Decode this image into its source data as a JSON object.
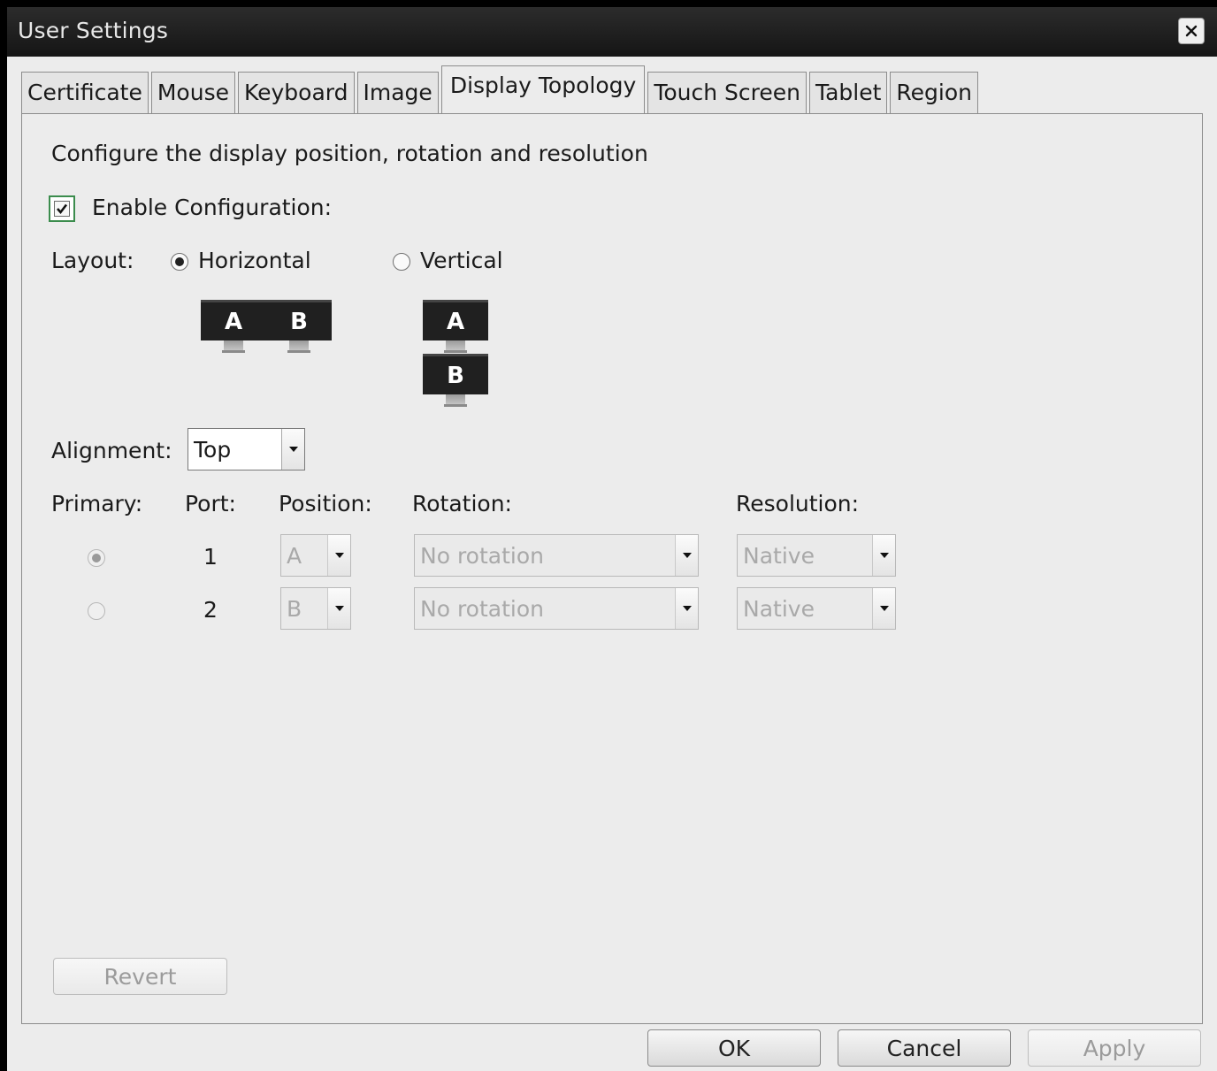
{
  "window": {
    "title": "User Settings",
    "close_icon": "close-icon"
  },
  "tabs": [
    {
      "label": "Certificate",
      "active": false
    },
    {
      "label": "Mouse",
      "active": false
    },
    {
      "label": "Keyboard",
      "active": false
    },
    {
      "label": "Image",
      "active": false
    },
    {
      "label": "Display Topology",
      "active": true
    },
    {
      "label": "Touch Screen",
      "active": false
    },
    {
      "label": "Tablet",
      "active": false
    },
    {
      "label": "Region",
      "active": false
    }
  ],
  "panel": {
    "description": "Configure the display position, rotation and resolution",
    "enable": {
      "label": "Enable Configuration:",
      "checked": true
    },
    "layout": {
      "label": "Layout:",
      "options": [
        {
          "label": "Horizontal",
          "selected": true,
          "monitors": [
            "A",
            "B"
          ]
        },
        {
          "label": "Vertical",
          "selected": false,
          "monitors": [
            "A",
            "B"
          ]
        }
      ]
    },
    "alignment": {
      "label": "Alignment:",
      "value": "Top"
    },
    "table": {
      "headers": {
        "primary": "Primary:",
        "port": "Port:",
        "position": "Position:",
        "rotation": "Rotation:",
        "resolution": "Resolution:"
      },
      "rows": [
        {
          "primary": true,
          "port": "1",
          "position": "A",
          "rotation": "No rotation",
          "resolution": "Native"
        },
        {
          "primary": false,
          "port": "2",
          "position": "B",
          "rotation": "No rotation",
          "resolution": "Native"
        }
      ]
    },
    "revert_label": "Revert"
  },
  "footer": {
    "ok_label": "OK",
    "cancel_label": "Cancel",
    "apply_label": "Apply"
  },
  "colors": {
    "titlebar": "#1e1e1e",
    "background": "#ececec",
    "focus_border": "#3b8c4d"
  }
}
